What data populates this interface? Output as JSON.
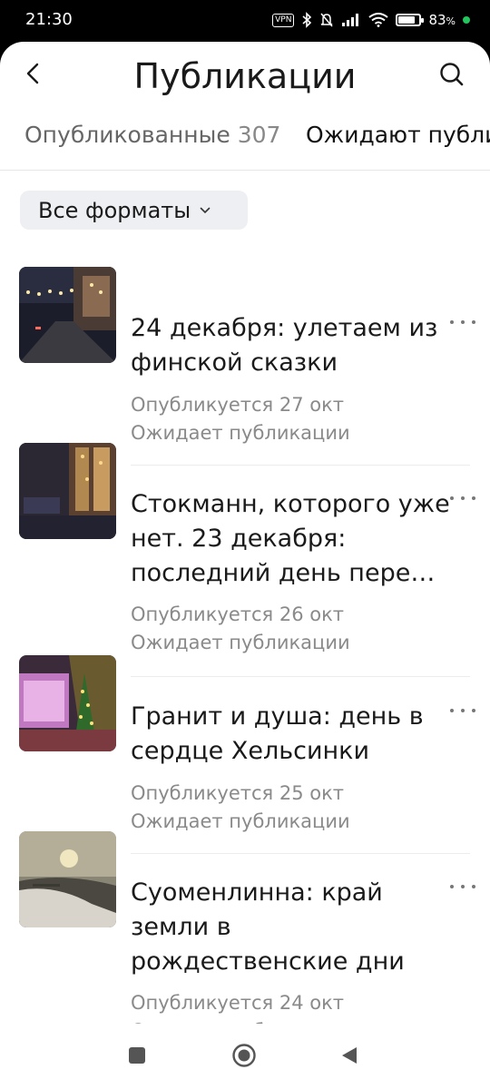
{
  "status_bar": {
    "time": "21:30",
    "vpn": "VPN",
    "battery_percent": "83",
    "battery_unit": "%",
    "battery_level": 0.83,
    "charging_color": "#22c55e"
  },
  "header": {
    "title": "Публикации",
    "back_icon": "back-arrow-icon",
    "search_icon": "search-icon"
  },
  "tabs": [
    {
      "label": "Опубликованные",
      "count": "307",
      "active": false
    },
    {
      "label": "Ожидают публи",
      "count": "",
      "active": true
    }
  ],
  "filter": {
    "label": "Все форматы",
    "icon": "chevron-down-icon"
  },
  "items": [
    {
      "title_line1": "24 декабря: улетаем из",
      "title_line2": "финской сказки",
      "title_line3": "",
      "scheduled": "Опубликуется 27 окт",
      "status": "Ожидает публикации",
      "more_icon": "more-dots-icon"
    },
    {
      "title_line1": "Стокманн, которого уже",
      "title_line2": "нет. 23 декабря:",
      "title_line3": "последний день пере…",
      "scheduled": "Опубликуется 26 окт",
      "status": "Ожидает публикации",
      "more_icon": "more-dots-icon"
    },
    {
      "title_line1": "Гранит и душа: день в",
      "title_line2": "сердце Хельсинки",
      "title_line3": "",
      "scheduled": "Опубликуется 25 окт",
      "status": "Ожидает публикации",
      "more_icon": "more-dots-icon"
    },
    {
      "title_line1": "Суоменлинна: край",
      "title_line2": "земли в",
      "title_line3": "рождественские дни",
      "scheduled": "Опубликуется 24 окт",
      "status": "Ожидает публикации",
      "more_icon": "more-dots-icon"
    }
  ],
  "nav": {
    "recent_icon": "recent-apps-icon",
    "home_icon": "home-icon",
    "back_icon": "back-triangle-icon"
  }
}
